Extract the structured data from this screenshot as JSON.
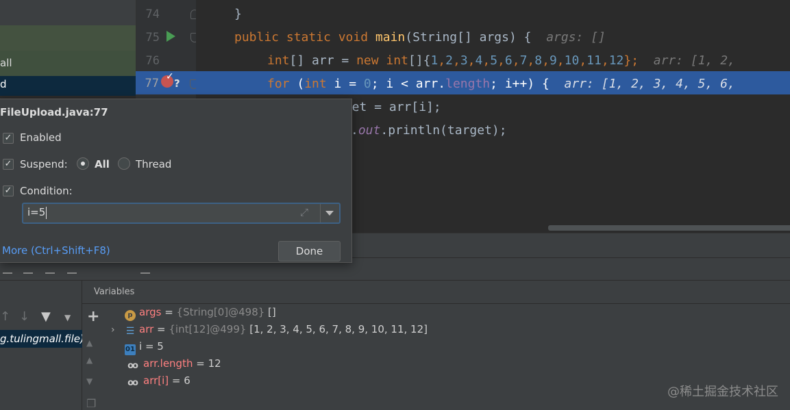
{
  "project_panel": {
    "row_1": "all",
    "row_3": "d"
  },
  "gutter": {
    "lines": [
      "74",
      "75",
      "76",
      "77"
    ],
    "breakpoint_question": "?"
  },
  "editor": {
    "line_74": "}",
    "line_75": {
      "kw1": "public static void ",
      "fn": "main",
      "rest": "(String[] args) {",
      "hint": "args: []"
    },
    "line_76": {
      "kw1": "int",
      "mid": "[] arr = ",
      "kw2": "new int",
      "open": "[]{",
      "nums": [
        "1",
        "2",
        "3",
        "4",
        "5",
        "6",
        "7",
        "8",
        "9",
        "10",
        "11",
        "12"
      ],
      "close": "};",
      "hint": "arr: [1, 2,"
    },
    "line_77": {
      "kw1": "for",
      "p1": " (",
      "kw2": "int",
      "p2": " i = ",
      "zero": "0",
      "p3": "; i < arr.",
      "fld": "length",
      "p4": "; i++) {",
      "hint": "arr: [1, 2, 3, 4, 5, 6,"
    },
    "line_78": "rget = arr[i];",
    "line_79": {
      "dot": ".",
      "fld": "out",
      "rest": ".println(target);"
    }
  },
  "breakpoint_popup": {
    "title": "FileUpload.java:77",
    "enabled_label": "Enabled",
    "suspend_label": "Suspend:",
    "all_label": "All",
    "thread_label": "Thread",
    "condition_label": "Condition:",
    "condition_value": "i=5",
    "more_link": "More (Ctrl+Shift+F8)",
    "done_label": "Done",
    "check_mark": "✓"
  },
  "debugger": {
    "frame": "g.tulingmall.file)",
    "variables_title": "Variables",
    "variables": [
      {
        "name": "args",
        "op": " = ",
        "meta": "{String[0]@498} ",
        "value": "[]"
      },
      {
        "name": "arr",
        "op": " = ",
        "meta": "{int[12]@499} ",
        "value": "[1, 2, 3, 4, 5, 6, 7, 8, 9, 10, 11, 12]"
      },
      {
        "name": "i",
        "op": " = ",
        "value": "5"
      },
      {
        "name": "arr.length",
        "op": " = ",
        "value": "12"
      },
      {
        "name": "arr[i]",
        "op": " = ",
        "value": "6"
      }
    ],
    "icon_labels": {
      "param": "p",
      "int": "01"
    }
  },
  "watermark": "@稀土掘金技术社区"
}
